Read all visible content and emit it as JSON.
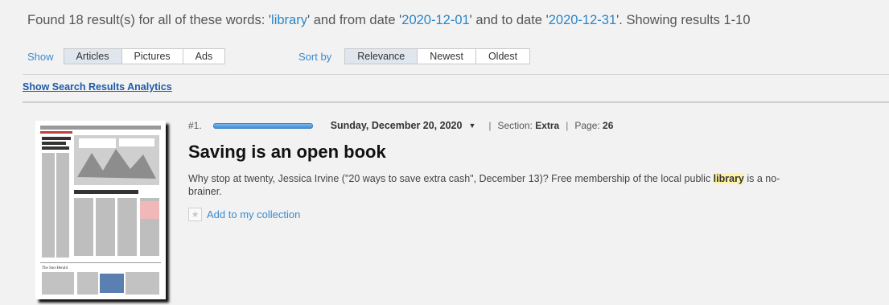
{
  "summary": {
    "prefix": "Found 18 result(s) for all of these words: '",
    "term1": "library",
    "mid1": "' and from date '",
    "term2": "2020-12-01",
    "mid2": "' and to date '",
    "term3": "2020-12-31",
    "suffix": "'. Showing results 1-10"
  },
  "show": {
    "label": "Show",
    "options": [
      "Articles",
      "Pictures",
      "Ads"
    ],
    "selected": "Articles"
  },
  "sort": {
    "label": "Sort by",
    "options": [
      "Relevance",
      "Newest",
      "Oldest"
    ],
    "selected": "Relevance"
  },
  "analytics_link": "Show Search Results Analytics",
  "results": [
    {
      "index": "#1.",
      "relevance": 1.0,
      "date": "Sunday, December 20, 2020",
      "section_label": "Section:",
      "section": "Extra",
      "page_label": "Page:",
      "page": "26",
      "title": "Saving is an open book",
      "snippet_before": "Why stop at twenty, Jessica Irvine (\"20 ways to save extra cash\", December 13)? Free membership of the local public ",
      "snippet_highlight": "library",
      "snippet_after": " is a no-brainer.",
      "collect_label": "Add to my collection"
    }
  ],
  "icons": {
    "caret": "caret-down-icon",
    "star": "star-icon"
  },
  "colors": {
    "link": "#3a8ad0",
    "term": "#2a86c8",
    "highlight": "#fff3a8"
  }
}
